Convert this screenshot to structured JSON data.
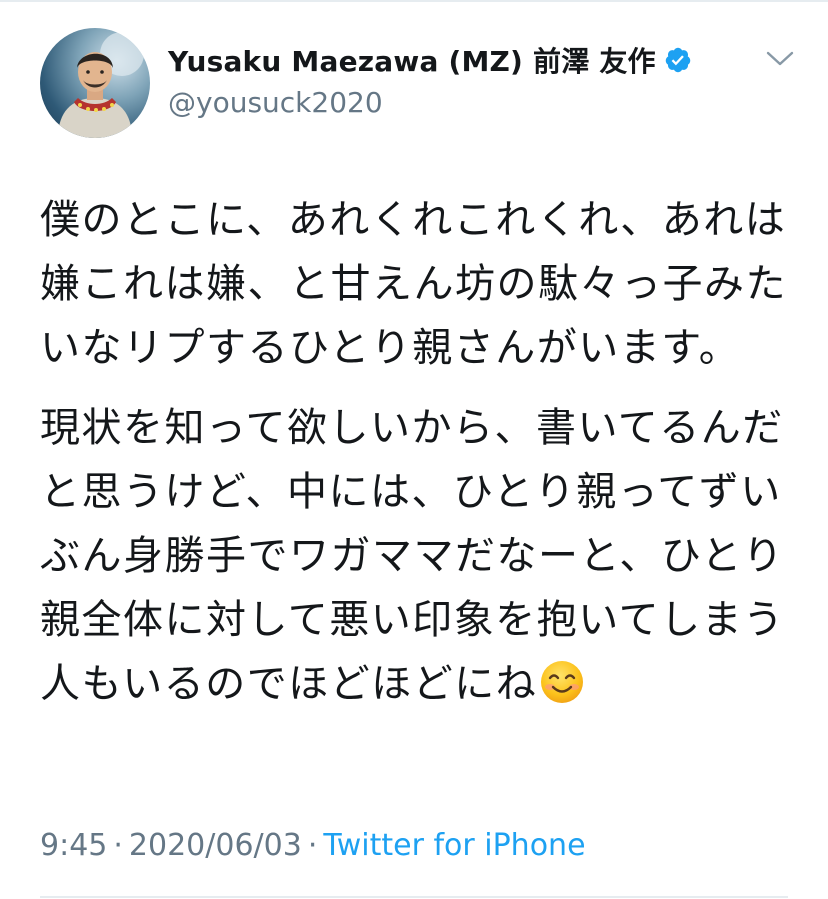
{
  "tweet": {
    "author": {
      "display_name": "Yusaku Maezawa (MZ) 前澤 友作",
      "handle": "@yousuck2020",
      "verified": true,
      "avatar_icon": "astronaut-portrait-avatar"
    },
    "paragraphs": [
      "僕のとこに、あれくれこれくれ、あれは嫌これは嫌、と甘えん坊の駄々っ子みたいなリプするひとり親さんがいます。",
      "現状を知って欲しいから、書いてるんだと思うけど、中には、ひとり親ってずいぶん身勝手でワガママだなーと、ひとり親全体に対して悪い印象を抱いてしまう人もいるのでほどほどにね"
    ],
    "trailing_emoji": "smiling-face-emoji",
    "time": "9:45",
    "date": "2020/06/03",
    "separator": "·",
    "source": "Twitter for iPhone"
  },
  "colors": {
    "text": "#14171a",
    "secondary": "#657786",
    "accent": "#1da1f2",
    "divider": "#e6ecf0"
  },
  "icons": {
    "verified": "verified-badge-icon",
    "menu": "chevron-down-icon"
  }
}
